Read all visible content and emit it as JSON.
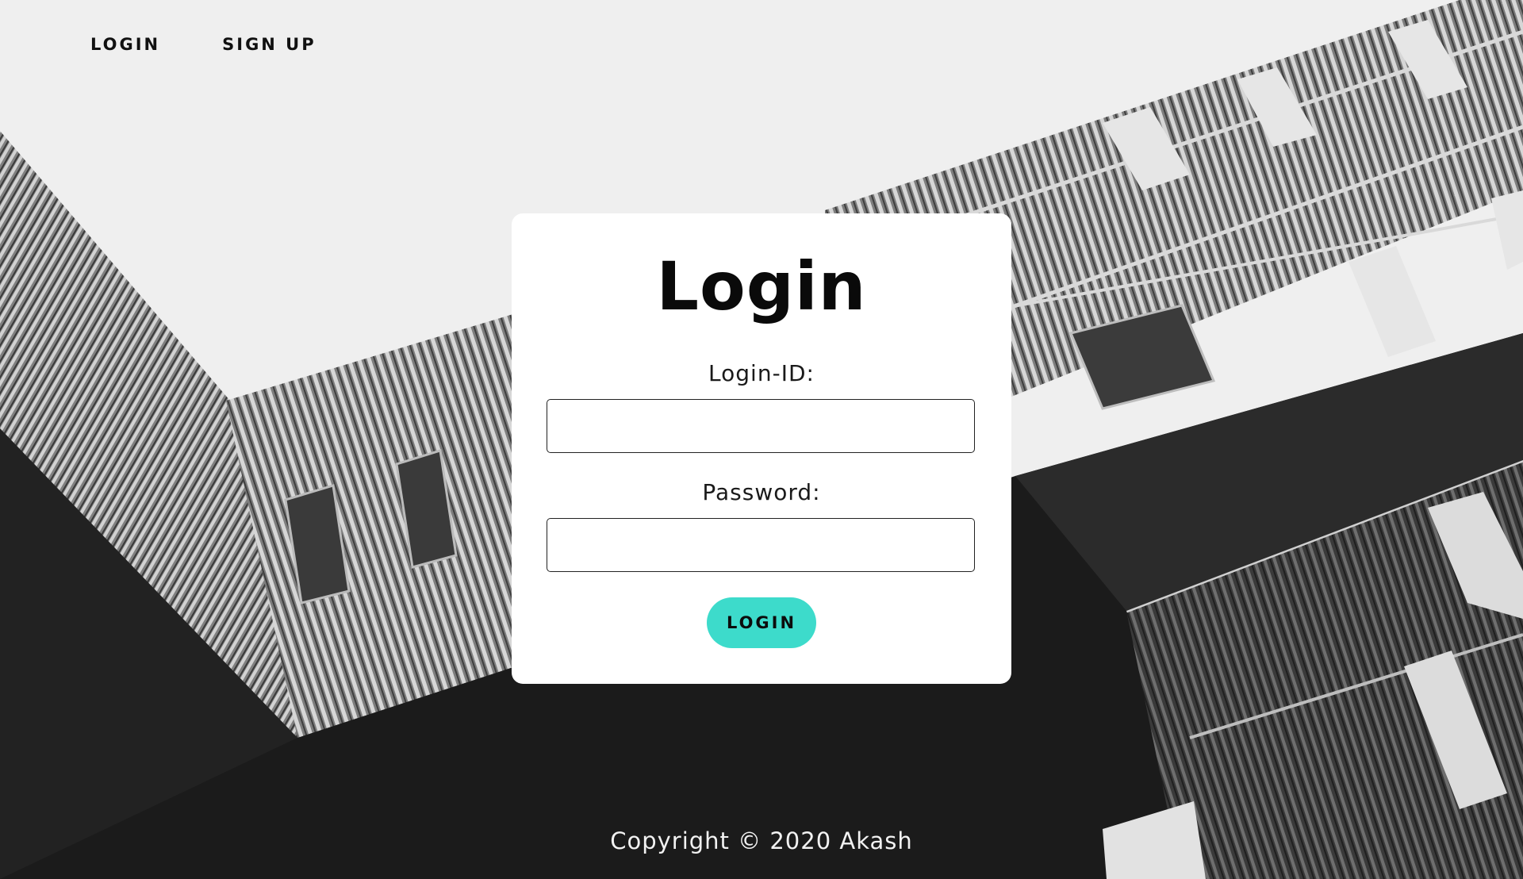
{
  "nav": {
    "login_label": "LOGIN",
    "signup_label": "SIGN UP"
  },
  "form": {
    "title": "Login",
    "login_id_label": "Login-ID:",
    "login_id_value": "",
    "password_label": "Password:",
    "password_value": "",
    "submit_label": "LOGIN"
  },
  "footer": {
    "copyright": "Copyright © 2020 Akash"
  },
  "colors": {
    "accent": "#3ddbcb",
    "card_bg": "#ffffff",
    "sky": "#efefef",
    "dark_ground": "#1a1a1a"
  },
  "background": {
    "description_icon": "building-photo"
  }
}
